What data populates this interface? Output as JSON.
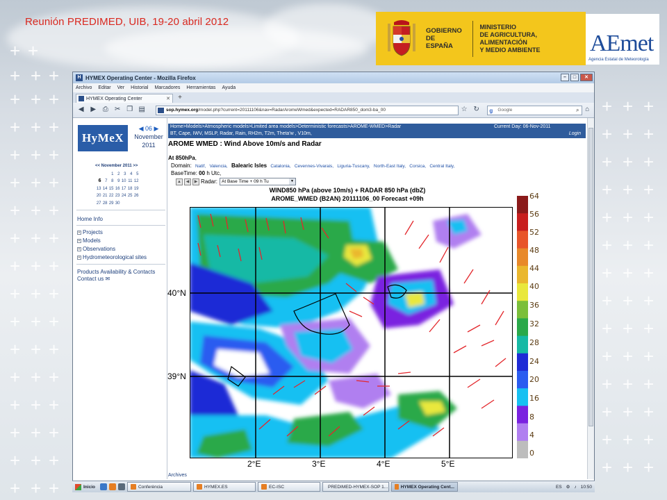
{
  "slide": {
    "title": "Reunión PREDIMED, UIB, 19-20 abril 2012",
    "logo_gov_line1": "GOBIERNO",
    "logo_gov_line2": "DE ESPAÑA",
    "logo_min_line1": "MINISTERIO",
    "logo_min_line2": "DE AGRICULTURA, ALIMENTACIÓN",
    "logo_min_line3": "Y MEDIO AMBIENTE",
    "logo_aemet": "AEmet",
    "logo_aemet_sub": "Agencia Estatal de Meteorología"
  },
  "browser": {
    "window_title": "HYMEX Operating Center - Mozilla Firefox",
    "menu": [
      "Archivo",
      "Editar",
      "Ver",
      "Historial",
      "Marcadores",
      "Herramientas",
      "Ayuda"
    ],
    "tab_title": "HYMEX Operating Center",
    "url_host": "sop.hymex.org",
    "url_path": "/model.php?current=20111106&nav=RadarAromeWmed&expected=RADAR850_dom3-ba_00",
    "search_placeholder": "Google",
    "search_engine_icon": "g-icon"
  },
  "sidebar": {
    "logo": "HyMeX",
    "date_day": "◀ 06 ▶",
    "date_month": "November",
    "date_year": "2011",
    "cal_header": "<< November 2011 >>",
    "cal_rows": [
      [
        "",
        "",
        "1",
        "2",
        "3",
        "4",
        "5"
      ],
      [
        "6",
        "7",
        "8",
        "9",
        "10",
        "11",
        "12"
      ],
      [
        "13",
        "14",
        "15",
        "16",
        "17",
        "18",
        "19"
      ],
      [
        "20",
        "21",
        "22",
        "23",
        "24",
        "25",
        "26"
      ],
      [
        "27",
        "28",
        "29",
        "30",
        "",
        "",
        ""
      ]
    ],
    "home_info": "Home Info",
    "tree": [
      "Projects",
      "Models",
      "Observations",
      "Hydrometeorological sites"
    ],
    "products": "Products Availability & Contacts",
    "contact": "Contact us"
  },
  "page": {
    "breadcrumb": "Home>Models>Atmospheric models>Limited area models>Deterministic forecasts>AROME-WMED>Radar",
    "current_day": "Current Day: 06-Nov-2011",
    "params": "BT, Cape, IWV, MSLP, Radar, Rain, RH2m, T2m, Theta'w , V10m,",
    "login": "Login",
    "heading": "AROME WMED : Wind Above 10m/s and Radar",
    "at_level_prefix": "At",
    "at_level_value": "850hPa",
    "domain_label": "Domain:",
    "domains": [
      "Natif,",
      "Valencia,",
      "Balearic Isles",
      "Catalonia,",
      "Cevennes-Vivarais,",
      "Liguria-Tuscany,",
      "North-East Italy,",
      "Corsica,",
      "Central Italy,"
    ],
    "selected_domain_index": 2,
    "basetime_label": "BaseTime:",
    "basetime_value": "00",
    "basetime_unit": "h Utc,",
    "radar_label": "Radar:",
    "radar_select": "At Base Time + 09 h Tu",
    "footer": "Archives"
  },
  "map": {
    "title_line1": "WIND850 hPa (above 10m/s) + RADAR 850 hPa (dbZ)",
    "title_line2": "AROME_WMED (B2AN) 20111106_00 Forecast +09h",
    "lat_labels": [
      "40°N",
      "39°N"
    ],
    "lon_labels": [
      "2°E",
      "3°E",
      "4°E",
      "5°E"
    ],
    "colorbar_labels": [
      "64",
      "56",
      "52",
      "48",
      "44",
      "40",
      "36",
      "32",
      "28",
      "24",
      "20",
      "16",
      "8",
      "4",
      "0"
    ],
    "colorbar_colors": [
      "#8b1a1a",
      "#c81e1e",
      "#e8552a",
      "#e8892a",
      "#eab72e",
      "#e9e83c",
      "#7bbf3b",
      "#2aa94a",
      "#16b9a5",
      "#1e2bd6",
      "#2a5cf0",
      "#17c0f2",
      "#7a22e0",
      "#b07ff0",
      "#bdbdbd"
    ]
  },
  "taskbar": {
    "start": "Inicio",
    "items": [
      "Conferència",
      "HYMEX.ES",
      "EC-ISC",
      "PREDIMED-HYMEX-SOP 1...",
      "HYMEX Operating Cent..."
    ],
    "active_index": 4,
    "lang": "ES",
    "time": "10:50"
  }
}
